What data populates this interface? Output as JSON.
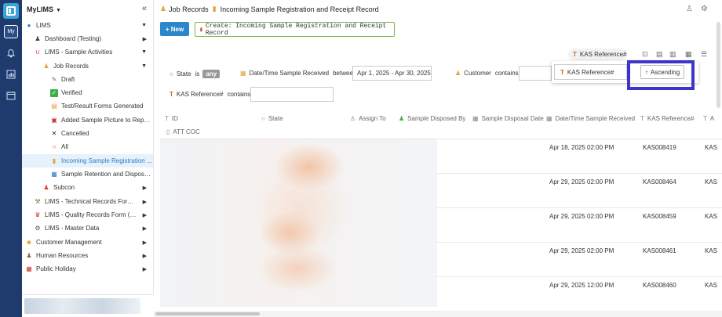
{
  "app": {
    "rail_my_label": "My",
    "workspace_title": "MyLIMS"
  },
  "sidebar": {
    "items": [
      {
        "label": "LIMS",
        "icon": "globe-icon"
      },
      {
        "label": "Dashboard (Testing)",
        "icon": "person-icon"
      },
      {
        "label": "LIMS - Sample Activities",
        "icon": "magnet-icon"
      },
      {
        "label": "Job Records",
        "icon": "folder-user-icon"
      },
      {
        "label": "Draft",
        "icon": "draft-icon"
      },
      {
        "label": "Verified",
        "icon": "check-box-icon"
      },
      {
        "label": "Test/Result Forms Generated",
        "icon": "forms-icon"
      },
      {
        "label": "Added Sample Picture to Repor...",
        "icon": "picture-icon"
      },
      {
        "label": "Cancelled",
        "icon": "x-icon"
      },
      {
        "label": "All",
        "icon": "circle-icon"
      },
      {
        "label": "Incoming Sample Registration ...",
        "icon": "notebook-icon"
      },
      {
        "label": "Sample Retention and Disposal...",
        "icon": "retention-icon"
      },
      {
        "label": "Subcon",
        "icon": "subcon-icon"
      },
      {
        "label": "LIMS - Technical Records Form (T...",
        "icon": "tools-icon"
      },
      {
        "label": "LIMS - Quality Records Form (QRF)",
        "icon": "quality-icon"
      },
      {
        "label": "LIMS - Master Data",
        "icon": "gear-icon"
      },
      {
        "label": "Customer Management",
        "icon": "smiley-icon"
      },
      {
        "label": "Human Resources",
        "icon": "people-icon"
      },
      {
        "label": "Public Holiday",
        "icon": "calendar-icon"
      }
    ]
  },
  "header": {
    "crumb_parent": "Job Records",
    "crumb_current": "Incoming Sample Registration and Receipt Record"
  },
  "toolbar": {
    "new_label": "+ New",
    "create_label": "Create: Incoming Sample Registration and Receipt Record"
  },
  "filters": {
    "state_label": "State",
    "state_op": "is",
    "state_value": "any",
    "date_label": "Date/Time Sample Received",
    "date_op": "between",
    "date_value": "Apr 1, 2025 - Apr 30, 2025",
    "customer_label": "Customer",
    "customer_op": "contains",
    "kas_label": "KAS Reference#",
    "kas_op": "contains"
  },
  "sort": {
    "chip_label": "KAS Reference#",
    "field_label": "KAS Reference#",
    "direction_label": "Ascending"
  },
  "table": {
    "columns": [
      "ID",
      "State",
      "Assign To",
      "Sample Disposed By",
      "Sample Disposal Date",
      "Date/Time Sample Received",
      "KAS Reference#",
      "A"
    ],
    "second_row_column": "ATT COC",
    "rows": [
      {
        "received": "Apr 18, 2025 02:00 PM",
        "kas": "KAS008419",
        "extra": "KAS"
      },
      {
        "received": "Apr 29, 2025 02:00 PM",
        "kas": "KAS008464",
        "extra": "KAS"
      },
      {
        "received": "Apr 29, 2025 02:00 PM",
        "kas": "KAS008459",
        "extra": "KAS"
      },
      {
        "received": "Apr 29, 2025 02:00 PM",
        "kas": "KAS008461",
        "extra": "KAS"
      },
      {
        "received": "Apr 29, 2025 12:00 PM",
        "kas": "KAS008460",
        "extra": "KAS"
      }
    ]
  }
}
